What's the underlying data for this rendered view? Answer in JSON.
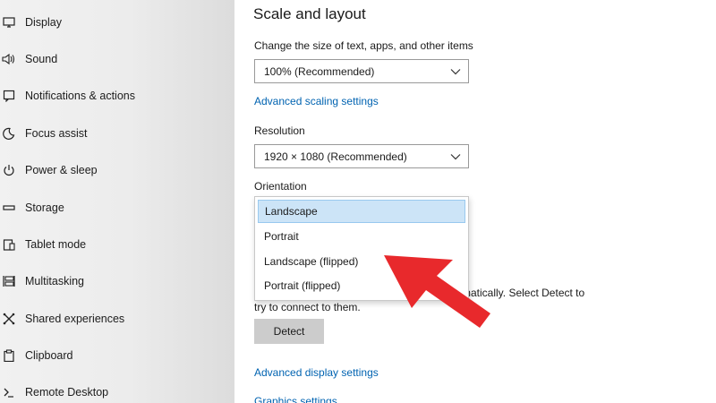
{
  "sidebar": {
    "items": [
      {
        "label": "Display",
        "icon": "monitor-icon"
      },
      {
        "label": "Sound",
        "icon": "speaker-icon"
      },
      {
        "label": "Notifications & actions",
        "icon": "notification-icon"
      },
      {
        "label": "Focus assist",
        "icon": "moon-icon"
      },
      {
        "label": "Power & sleep",
        "icon": "power-icon"
      },
      {
        "label": "Storage",
        "icon": "storage-icon"
      },
      {
        "label": "Tablet mode",
        "icon": "tablet-icon"
      },
      {
        "label": "Multitasking",
        "icon": "multitasking-icon"
      },
      {
        "label": "Shared experiences",
        "icon": "shared-experiences-icon"
      },
      {
        "label": "Clipboard",
        "icon": "clipboard-icon"
      },
      {
        "label": "Remote Desktop",
        "icon": "remote-desktop-icon"
      }
    ]
  },
  "main": {
    "section_title": "Scale and layout",
    "scale": {
      "label": "Change the size of text, apps, and other items",
      "value": "100% (Recommended)",
      "advanced_link": "Advanced scaling settings"
    },
    "resolution": {
      "label": "Resolution",
      "value": "1920 × 1080 (Recommended)"
    },
    "orientation": {
      "label": "Orientation",
      "options": [
        "Landscape",
        "Portrait",
        "Landscape (flipped)",
        "Portrait (flipped)"
      ],
      "selected": "Landscape"
    },
    "detect": {
      "text_partial_line1": "matically. Select Detect to",
      "text_line2": "try to connect to them.",
      "button_label": "Detect"
    },
    "advanced_display_link": "Advanced display settings",
    "graphics_link": "Graphics settings"
  },
  "annotation": {
    "arrow_color": "#e8292c"
  },
  "colors": {
    "accent_link": "#0063b1",
    "selected_option_bg": "#cce4f7",
    "button_bg": "#cccccc"
  }
}
